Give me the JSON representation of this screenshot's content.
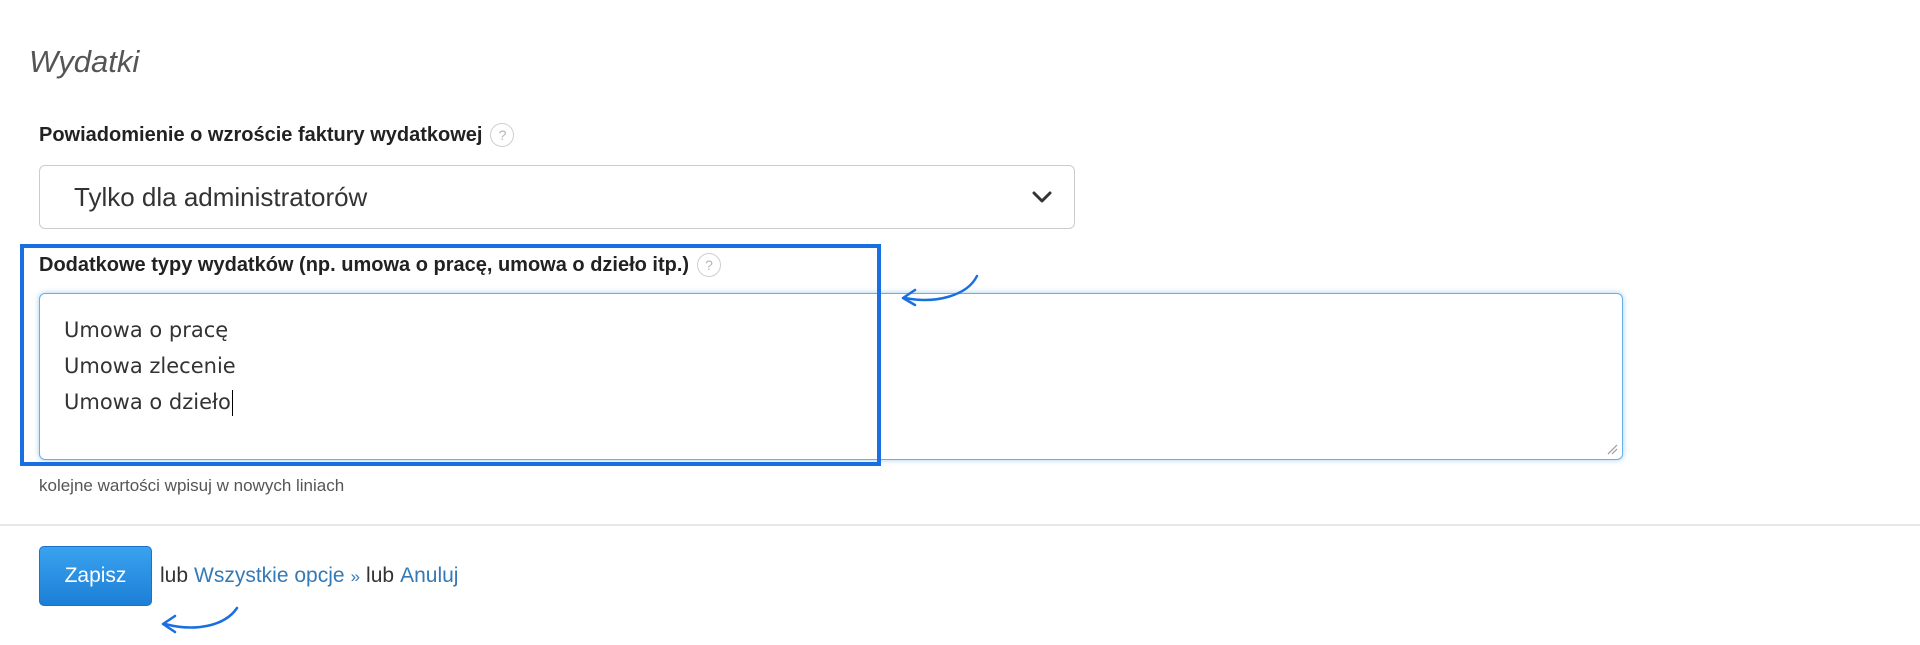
{
  "section": {
    "title": "Wydatki"
  },
  "notification_field": {
    "label": "Powiadomienie o wzroście faktury wydatkowej",
    "help_glyph": "?",
    "selected_value": "Tylko dla administratorów"
  },
  "expense_types_field": {
    "label": "Dodatkowe typy wydatków (np. umowa o pracę, umowa o dzieło itp.)",
    "help_glyph": "?",
    "lines": [
      "Umowa o pracę",
      "Umowa zlecenie",
      "Umowa o dzieło"
    ],
    "hint": "kolejne wartości wpisuj w nowych liniach"
  },
  "footer": {
    "save_label": "Zapisz",
    "or_1": "lub",
    "all_options_label": "Wszystkie opcje",
    "all_options_suffix": "»",
    "or_2": "lub",
    "cancel_label": "Anuluj"
  },
  "colors": {
    "accent": "#1a6fe0",
    "link": "#337ab7",
    "button": "#2a8ee2",
    "focus_border": "#66afe9"
  },
  "icons": {
    "help": "question-circle-icon",
    "select_arrow": "chevron-down-icon",
    "annotation": "curved-arrow-icon"
  }
}
